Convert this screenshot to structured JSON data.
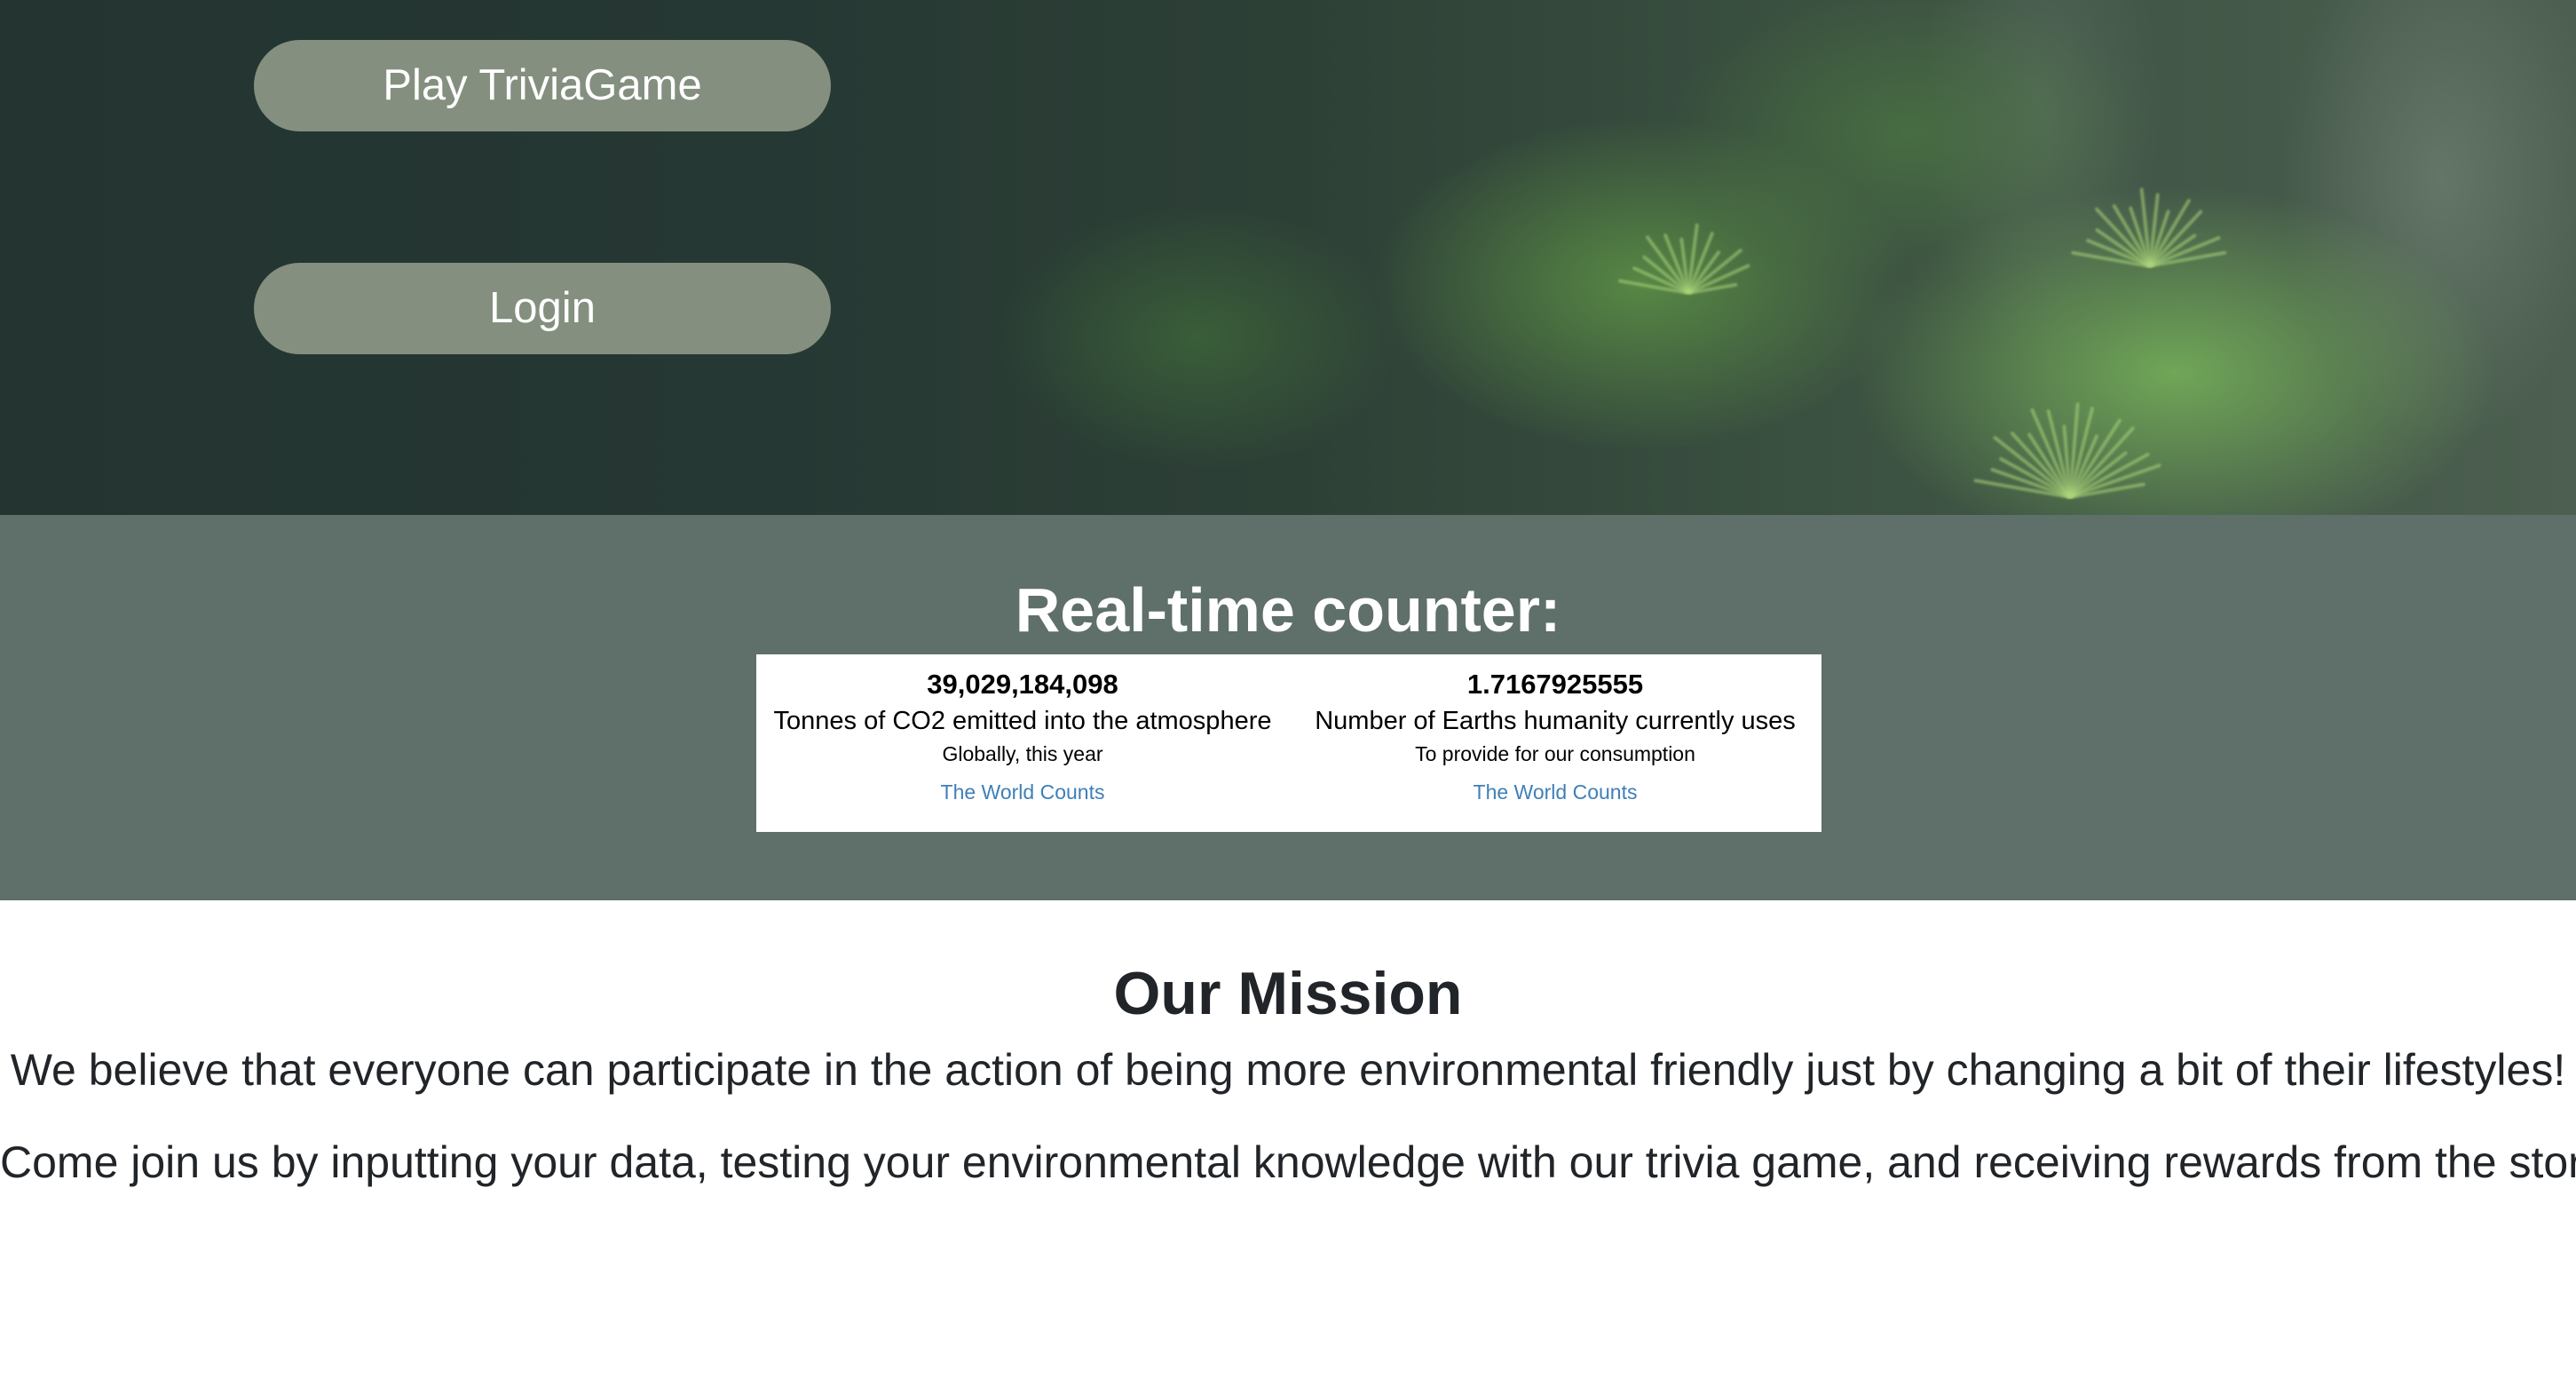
{
  "hero": {
    "play_label": "Play TriviaGame",
    "login_label": "Login"
  },
  "counter": {
    "title": "Real-time counter:",
    "items": [
      {
        "value": "39,029,184,098",
        "label": "Tonnes of CO2 emitted into the atmosphere",
        "sub": "Globally, this year",
        "link": "The World Counts"
      },
      {
        "value": "1.7167925555",
        "label": "Number of Earths humanity currently uses",
        "sub": "To provide for our consumption",
        "link": "The World Counts"
      }
    ]
  },
  "mission": {
    "title": "Our Mission",
    "paragraphs": [
      "We believe that everyone can participate in the action of being more environmental friendly just by changing a bit of their lifestyles!",
      "Come join us by inputting your data, testing your environmental knowledge with our trivia game, and receiving rewards from the store!"
    ]
  },
  "colors": {
    "button_bg": "#848f80",
    "counter_band_bg": "#5f6f6a",
    "link": "#3f7fb8"
  }
}
